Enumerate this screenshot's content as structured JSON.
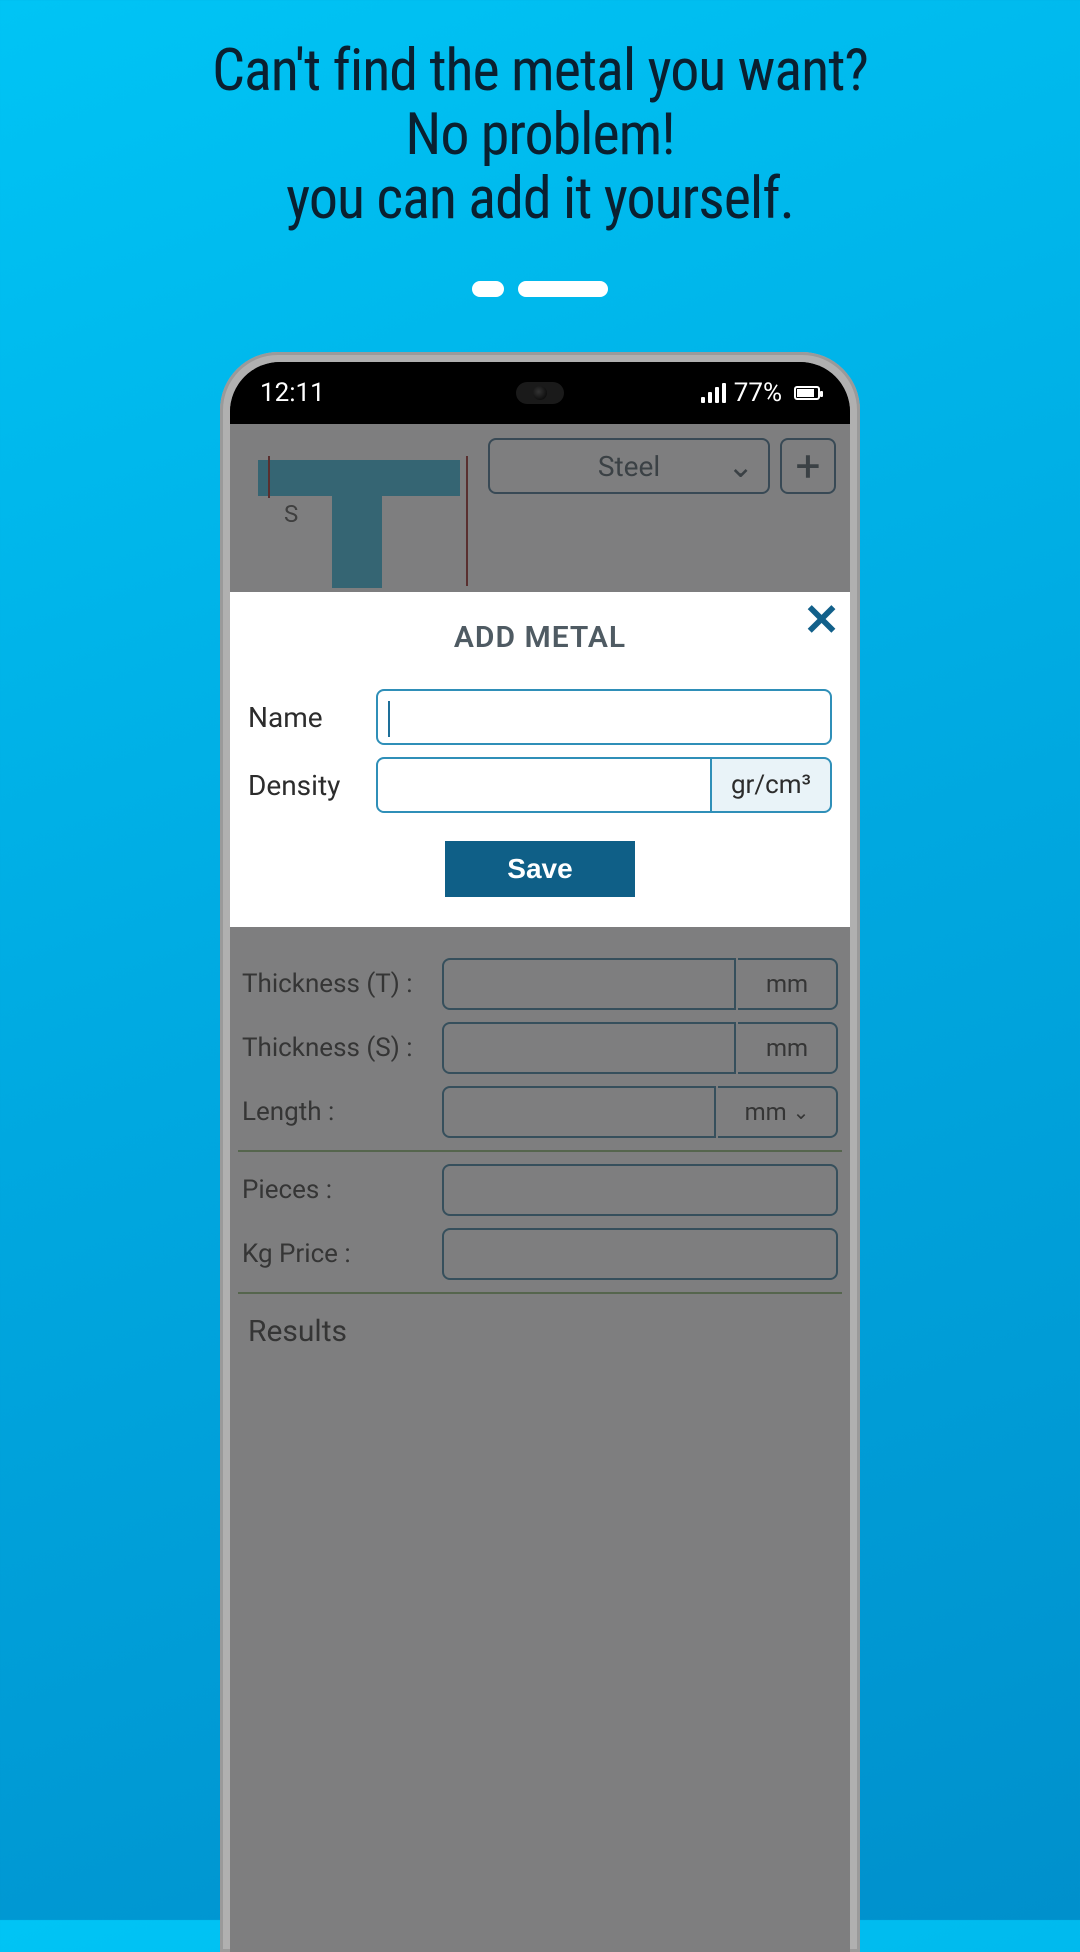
{
  "promo": {
    "line1": "Can't find the metal you want?",
    "line2": "No problem!",
    "line3": "you can add it yourself."
  },
  "pager": {
    "current": 2,
    "total": 2
  },
  "status": {
    "time": "12:11",
    "battery": "77%"
  },
  "app": {
    "metal_dropdown": "Steel",
    "rows": {
      "thickness_t": {
        "label": "Thickness (T) :",
        "unit": "mm"
      },
      "thickness_s": {
        "label": "Thickness (S) :",
        "unit": "mm"
      },
      "length": {
        "label": "Length :",
        "unit": "mm"
      },
      "pieces": {
        "label": "Pieces :"
      },
      "kg_price": {
        "label": "Kg Price :"
      }
    },
    "results_title": "Results"
  },
  "dialog": {
    "title": "ADD METAL",
    "name_label": "Name",
    "name_value": "",
    "density_label": "Density",
    "density_value": "",
    "density_unit": "gr/cm³",
    "save_label": "Save"
  }
}
